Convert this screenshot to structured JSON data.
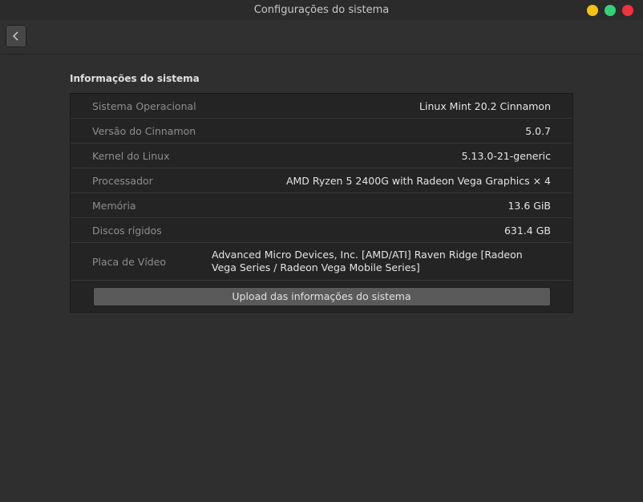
{
  "window": {
    "title": "Configurações do sistema",
    "controls": [
      "minimize",
      "maximize",
      "close"
    ]
  },
  "toolbar": {
    "back_icon": "chevron-left-icon"
  },
  "section": {
    "title": "Informações do sistema",
    "rows": [
      {
        "label": "Sistema Operacional",
        "value": "Linux Mint 20.2 Cinnamon"
      },
      {
        "label": "Versão do Cinnamon",
        "value": "5.0.7"
      },
      {
        "label": "Kernel do Linux",
        "value": "5.13.0-21-generic"
      },
      {
        "label": "Processador",
        "value": "AMD Ryzen 5 2400G with Radeon Vega Graphics × 4"
      },
      {
        "label": "Memória",
        "value": "13.6 GiB"
      },
      {
        "label": "Discos rígidos",
        "value": "631.4 GB"
      },
      {
        "label": "Placa de Vídeo",
        "value": "Advanced Micro Devices, Inc. [AMD/ATI] Raven Ridge [Radeon Vega Series / Radeon Vega Mobile Series]"
      }
    ],
    "upload_button": "Upload das informações do sistema"
  },
  "colors": {
    "background": "#2f2f2f",
    "panel": "#242424",
    "minimize": "#f5c211",
    "maximize": "#33d17a",
    "close": "#ed333b"
  }
}
